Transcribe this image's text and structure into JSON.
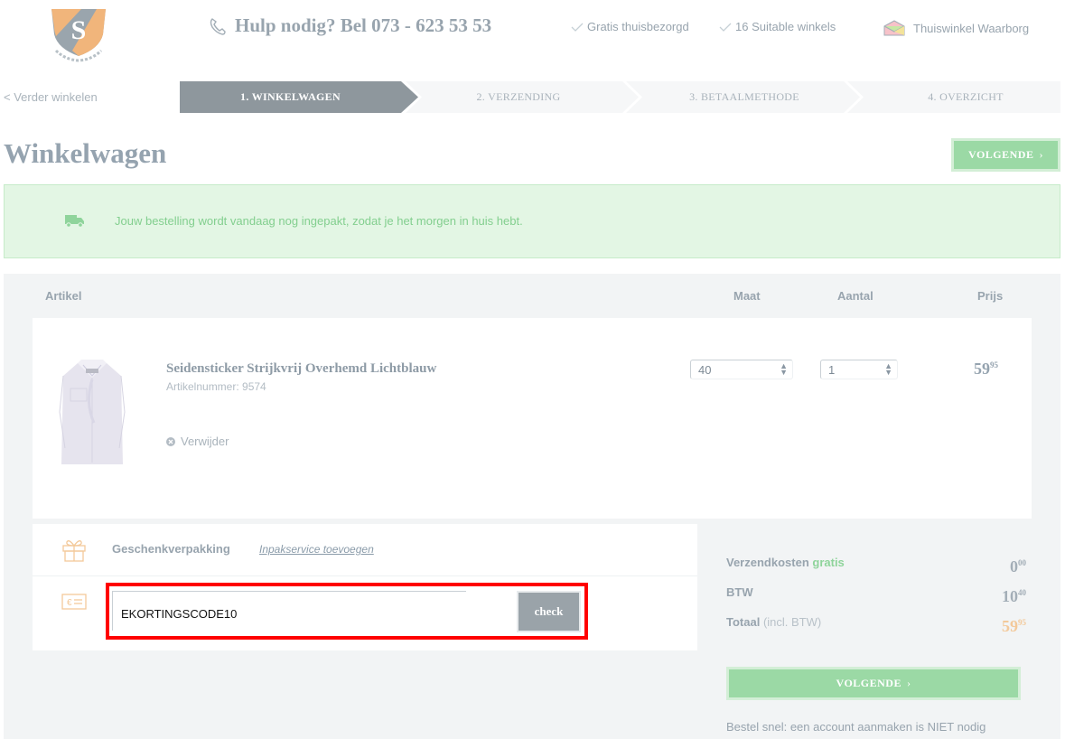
{
  "header": {
    "help_text": "Hulp nodig? Bel 073 - 623 53 53",
    "usp": [
      "Gratis thuisbezorgd",
      "16 Suitable winkels"
    ],
    "waarborg": "Thuiswinkel Waarborg",
    "logo_letter": "S"
  },
  "steps": {
    "back": "< Verder winkelen",
    "items": [
      {
        "label": "1. WINKELWAGEN",
        "active": true
      },
      {
        "label": "2. VERZENDING",
        "active": false
      },
      {
        "label": "3. BETAALMETHODE",
        "active": false
      },
      {
        "label": "4. OVERZICHT",
        "active": false
      }
    ]
  },
  "page_title": "Winkelwagen",
  "next_button": "VOLGENDE",
  "notice": "Jouw bestelling wordt vandaag nog ingepakt, zodat je het morgen in huis hebt.",
  "table": {
    "headers": {
      "artikel": "Artikel",
      "maat": "Maat",
      "aantal": "Aantal",
      "prijs": "Prijs"
    }
  },
  "product": {
    "name": "Seidensticker Strijkvrij Overhemd Lichtblauw",
    "article_number": "Artikelnummer: 9574",
    "remove": "Verwijder",
    "size": "40",
    "quantity": "1",
    "price_main": "59",
    "price_cents": "95"
  },
  "gift": {
    "label": "Geschenkverpakking",
    "link": "Inpakservice toevoegen"
  },
  "discount": {
    "value": "EKORTINGSCODE10",
    "button": "check"
  },
  "totals": {
    "shipping_label": "Verzendkosten",
    "shipping_free": "gratis",
    "shipping_main": "0",
    "shipping_cents": "00",
    "vat_label": "BTW",
    "vat_main": "10",
    "vat_cents": "40",
    "total_label": "Totaal",
    "total_note": "(incl. BTW)",
    "total_main": "59",
    "total_cents": "95"
  },
  "footnote": "Bestel snel: een account aanmaken is NIET nodig",
  "colors": {
    "accent_green": "#9bd9a5",
    "active_step": "#8e979d",
    "highlight": "#ff0000",
    "total_orange": "#f3c99a"
  }
}
